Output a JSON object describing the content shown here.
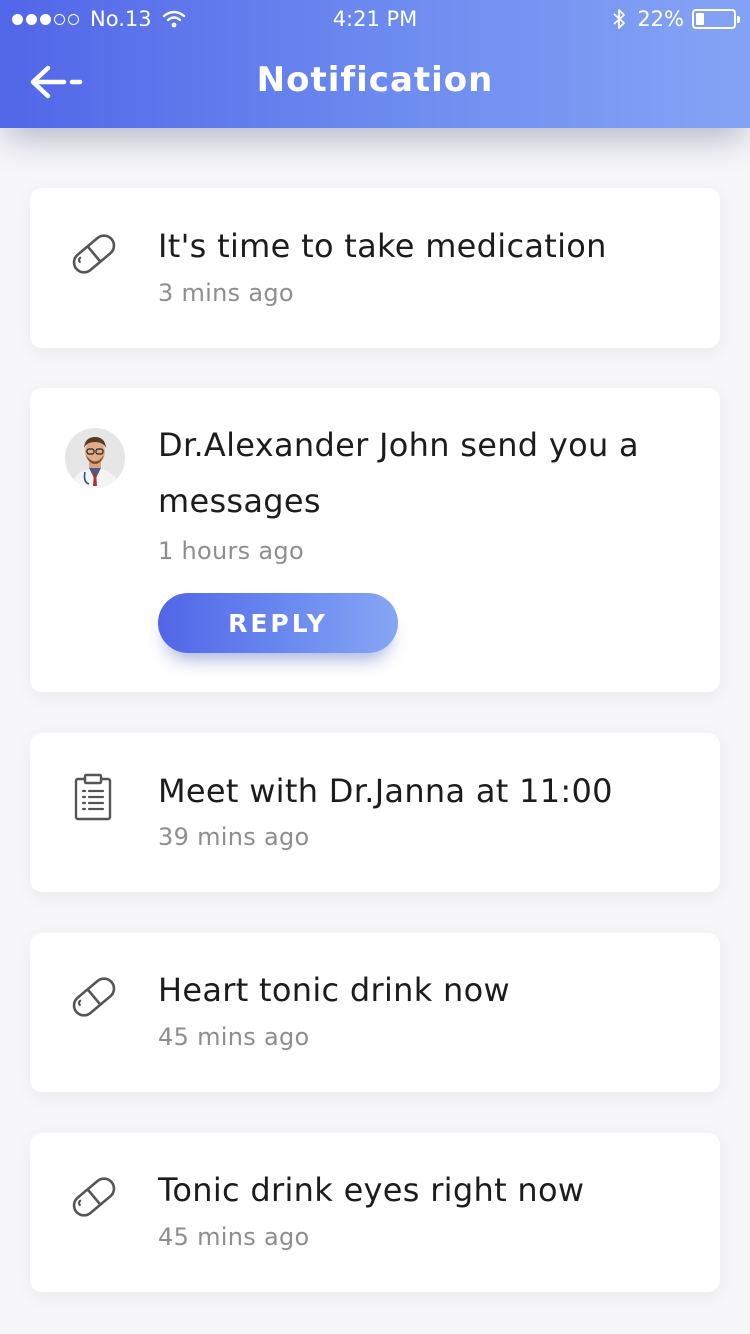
{
  "status_bar": {
    "carrier": "No.13",
    "time": "4:21 PM",
    "battery": "22%",
    "battery_level": 0.22
  },
  "header": {
    "title": "Notification"
  },
  "notifications": [
    {
      "icon": "pill-icon",
      "title": "It's time to take medication",
      "time": "3 mins ago"
    },
    {
      "icon": "doctor-avatar",
      "title": "Dr.Alexander John send you a messages",
      "time": "1 hours ago",
      "action_label": "REPLY"
    },
    {
      "icon": "clipboard-icon",
      "title": "Meet with Dr.Janna at 11:00",
      "time": "39 mins ago"
    },
    {
      "icon": "pill-icon",
      "title": "Heart tonic drink now",
      "time": "45 mins ago"
    },
    {
      "icon": "pill-icon",
      "title": "Tonic drink eyes right now",
      "time": "45 mins ago"
    }
  ],
  "colors": {
    "accent_start": "#5166e8",
    "accent_end": "#85a3f5",
    "background": "#f7f7f9",
    "muted_text": "#8e8e8e"
  }
}
